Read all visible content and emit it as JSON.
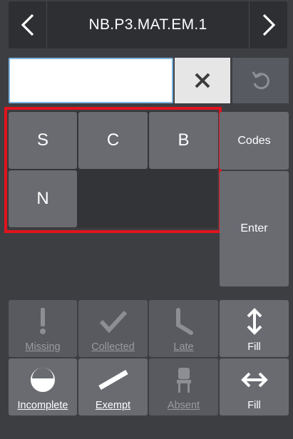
{
  "header": {
    "title": "NB.P3.MAT.EM.1"
  },
  "entry": {
    "value": ""
  },
  "codes": [
    {
      "label": "S"
    },
    {
      "label": "C"
    },
    {
      "label": "B"
    },
    {
      "label": "N"
    }
  ],
  "side_buttons": {
    "codes": "Codes",
    "enter": "Enter"
  },
  "status_buttons": {
    "missing": "Missing",
    "collected": "Collected",
    "late": "Late",
    "fill_vertical": "Fill",
    "incomplete": "Incomplete",
    "exempt": "Exempt",
    "absent": "Absent",
    "fill_horizontal": "Fill"
  },
  "colors": {
    "highlight": "#e1131d",
    "entry_border": "#7fb6e0",
    "tile": "#696b71",
    "background": "#3d3e42"
  }
}
